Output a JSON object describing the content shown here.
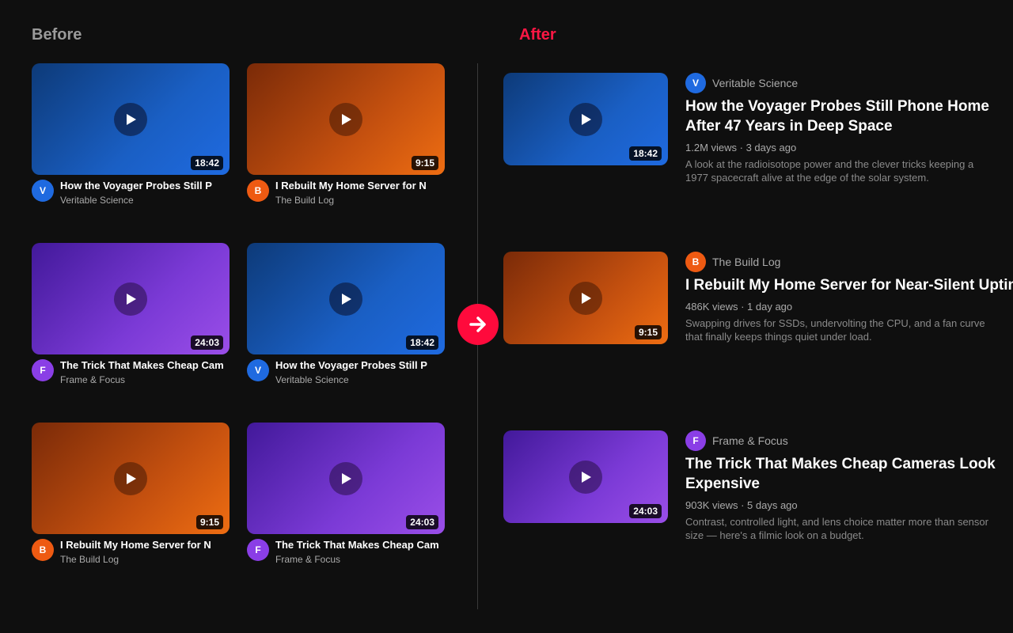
{
  "headings": {
    "before": "Before",
    "after": "After"
  },
  "colors": {
    "accent": "#ff1744",
    "background": "#0f0f0f",
    "avatar_v": "#1f6ae0",
    "avatar_b": "#ee5a12",
    "avatar_f": "#8a3ee6"
  },
  "before_grid": [
    {
      "title": "How the Voyager Probes Still P",
      "channel": "Veritable Science",
      "initial": "V",
      "duration": "18:42",
      "theme": "blue"
    },
    {
      "title": "I Rebuilt My Home Server for N",
      "channel": "The Build Log",
      "initial": "B",
      "duration": "9:15",
      "theme": "orange"
    },
    {
      "title": "The Trick That Makes Cheap Cam",
      "channel": "Frame & Focus",
      "initial": "F",
      "duration": "24:03",
      "theme": "purple"
    },
    {
      "title": "How the Voyager Probes Still P",
      "channel": "Veritable Science",
      "initial": "V",
      "duration": "18:42",
      "theme": "blue"
    },
    {
      "title": "I Rebuilt My Home Server for N",
      "channel": "The Build Log",
      "initial": "B",
      "duration": "9:15",
      "theme": "orange"
    },
    {
      "title": "The Trick That Makes Cheap Cam",
      "channel": "Frame & Focus",
      "initial": "F",
      "duration": "24:03",
      "theme": "purple"
    }
  ],
  "after_list": [
    {
      "title": "How the Voyager Probes Still Phone Home After 47 Years in Deep Space",
      "channel": "Veritable Science",
      "initial": "V",
      "duration": "18:42",
      "stats": "1.2M views · 3 days ago",
      "description": "A look at the radioisotope power and the clever tricks keeping a 1977 spacecraft alive at the edge of the solar system.",
      "theme": "blue"
    },
    {
      "title": "I Rebuilt My Home Server for Near-Silent Uptime",
      "channel": "The Build Log",
      "initial": "B",
      "duration": "9:15",
      "stats": "486K views · 1 day ago",
      "description": "Swapping drives for SSDs, undervolting the CPU, and a fan curve that finally keeps things quiet under load.",
      "theme": "orange"
    },
    {
      "title": "The Trick That Makes Cheap Cameras Look Expensive",
      "channel": "Frame & Focus",
      "initial": "F",
      "duration": "24:03",
      "stats": "903K views · 5 days ago",
      "description": "Contrast, controlled light, and lens choice matter more than sensor size — here's a filmic look on a budget.",
      "theme": "purple"
    }
  ]
}
